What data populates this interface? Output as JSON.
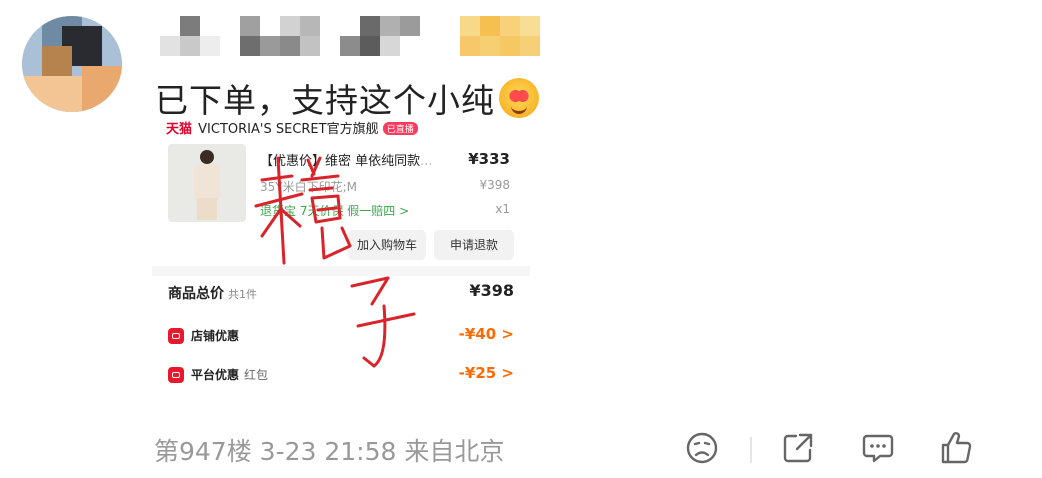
{
  "comment": {
    "text": "已下单，支持这个小纯",
    "emoji": "smiling-face-with-hearts-icon"
  },
  "screenshot": {
    "store": {
      "brand": "天猫",
      "name": "VICTORIA'S SECRET官方旗舰",
      "badge": "已直播"
    },
    "product": {
      "name": "【优惠价】维密 单依纯同款",
      "name_faded": "...",
      "price": "¥333",
      "spec": "35Y米白下印花;M",
      "original_price": "¥398",
      "tags": "退货宝  7天价保  假一赔四 >",
      "qty": "x1"
    },
    "buttons": {
      "add_to_cart": "加入购物车",
      "refund": "申请退款"
    },
    "total": {
      "label": "商品总价",
      "count": "共1件",
      "value": "¥398"
    },
    "discounts": [
      {
        "label": "店铺优惠",
        "sub": "",
        "value": "-¥40 >"
      },
      {
        "label": "平台优惠",
        "sub": "红包",
        "value": "-¥25 >"
      }
    ],
    "handwriting": "精子"
  },
  "meta": {
    "floor": "第947楼",
    "date": "3-23",
    "time": "21:58",
    "location": "来自北京"
  },
  "colors": {
    "tmall_red": "#e4002b",
    "discount_orange": "#ff6a00",
    "green_tag": "#3aa64b",
    "meta_grey": "#999999",
    "ink_red": "#d8242a"
  },
  "actions": [
    {
      "name": "dislike-icon"
    },
    {
      "name": "share-icon"
    },
    {
      "name": "comment-icon"
    },
    {
      "name": "like-icon"
    }
  ]
}
